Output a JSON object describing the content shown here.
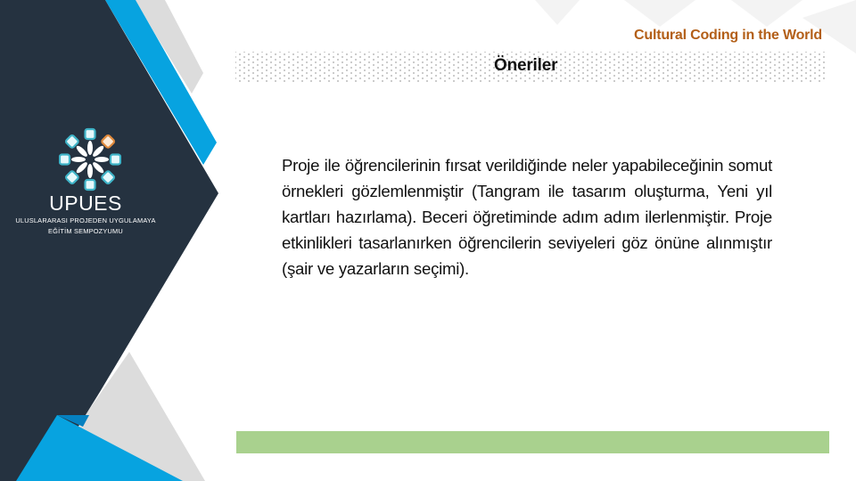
{
  "header": {
    "title": "Cultural Coding in the World"
  },
  "slide": {
    "title": "Öneriler",
    "body": "Proje ile öğrencilerinin fırsat verildiğinde neler yapabileceğinin somut örnekleri gözlemlenmiştir (Tangram ile tasarım oluşturma, Yeni yıl kartları hazırlama). Beceri öğretiminde adım adım ilerlenmiştir. Proje etkinlikleri tasarlanırken öğrencilerin seviyeleri göz önüne alınmıştır (şair ve yazarların seçimi)."
  },
  "logo": {
    "name": "UPUES",
    "line1": "ULUSLARARASI PROJEDEN UYGULAMAYA",
    "line2": "EĞİTİM SEMPOZYUMU",
    "icon": "rosette-logo-icon"
  },
  "colors": {
    "navy": "#253240",
    "blue": "#07a3e0",
    "dark_blue": "#0580c0",
    "gray": "#dcdcdc",
    "header_orange": "#b35f18",
    "green_bar": "#a9d18e",
    "logo_teal": "#3fb4c8",
    "logo_orange": "#e08a3c"
  }
}
